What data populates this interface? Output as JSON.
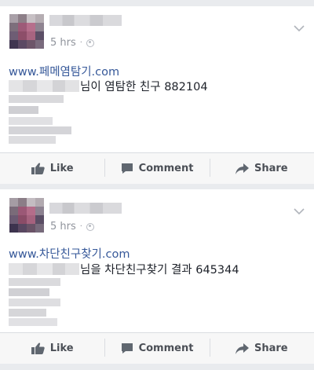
{
  "posts": [
    {
      "timestamp": "5 hrs",
      "link_text": "www.페메염탐기.com",
      "line_text": "님이 염탐한 친구 882104",
      "actions": {
        "like_label": "Like",
        "comment_label": "Comment",
        "share_label": "Share"
      }
    },
    {
      "timestamp": "5 hrs",
      "link_text": "www.차단친구찾기.com",
      "line_text": "님을 차단친구찾기 결과 645344",
      "actions": {
        "like_label": "Like",
        "comment_label": "Comment",
        "share_label": "Share"
      }
    }
  ],
  "icons": {
    "like": "thumbs-up-icon",
    "comment": "comment-bubble-icon",
    "share": "share-arrow-icon",
    "privacy": "globe-icon",
    "menu": "chevron-down-icon"
  },
  "colors": {
    "link": "#365899",
    "meta": "#90949c",
    "action_text": "#4b4f56",
    "background": "#e9ebee"
  }
}
